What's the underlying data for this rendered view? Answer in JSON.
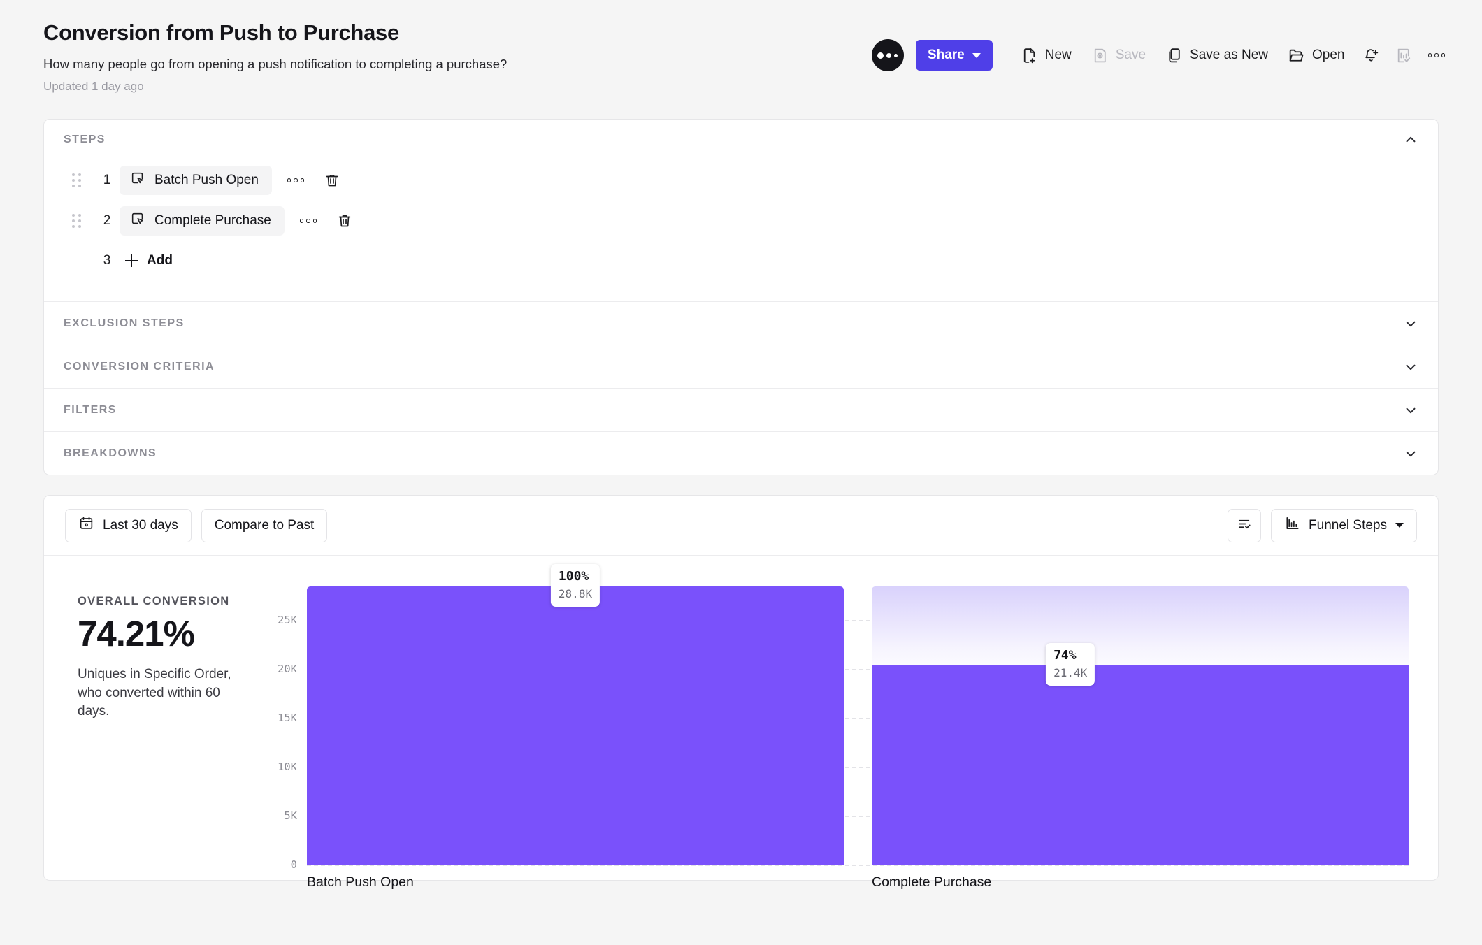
{
  "header": {
    "title": "Conversion from Push to Purchase",
    "subtitle": "How many people go from opening a push notification to completing a purchase?",
    "updated": "Updated 1 day ago"
  },
  "toolbar": {
    "share_label": "Share",
    "new_label": "New",
    "save_label": "Save",
    "save_as_new_label": "Save as New",
    "open_label": "Open",
    "accent_color": "#4f3fe8"
  },
  "steps_panel": {
    "title": "STEPS",
    "steps": [
      {
        "number": "1",
        "label": "Batch Push Open"
      },
      {
        "number": "2",
        "label": "Complete Purchase"
      }
    ],
    "add_number": "3",
    "add_label": "Add"
  },
  "sections": [
    {
      "label": "EXCLUSION STEPS"
    },
    {
      "label": "CONVERSION CRITERIA"
    },
    {
      "label": "FILTERS"
    },
    {
      "label": "BREAKDOWNS"
    }
  ],
  "chart_toolbar": {
    "date_range": "Last 30 days",
    "compare": "Compare to Past",
    "view_label": "Funnel Steps"
  },
  "summary": {
    "label": "OVERALL CONVERSION",
    "value": "74.21%",
    "description": "Uniques in Specific Order, who converted within 60 days."
  },
  "chart_data": {
    "type": "bar",
    "title": "Conversion from Push to Purchase",
    "categories": [
      "Batch Push Open",
      "Complete Purchase"
    ],
    "values": [
      28800,
      21400
    ],
    "value_labels": [
      "28.8K",
      "21.4K"
    ],
    "percent_labels": [
      "100%",
      "74%"
    ],
    "percents": [
      100,
      74
    ],
    "ylabel": "",
    "xlabel": "",
    "ylim": [
      0,
      28800
    ],
    "yticks": [
      0,
      5000,
      10000,
      15000,
      20000,
      25000
    ],
    "ytick_labels": [
      "0",
      "5K",
      "10K",
      "15K",
      "20K",
      "25K"
    ],
    "grid": true,
    "legend": "none",
    "bar_color": "#7a51fb",
    "ghost_color": "#d9d2fc"
  }
}
